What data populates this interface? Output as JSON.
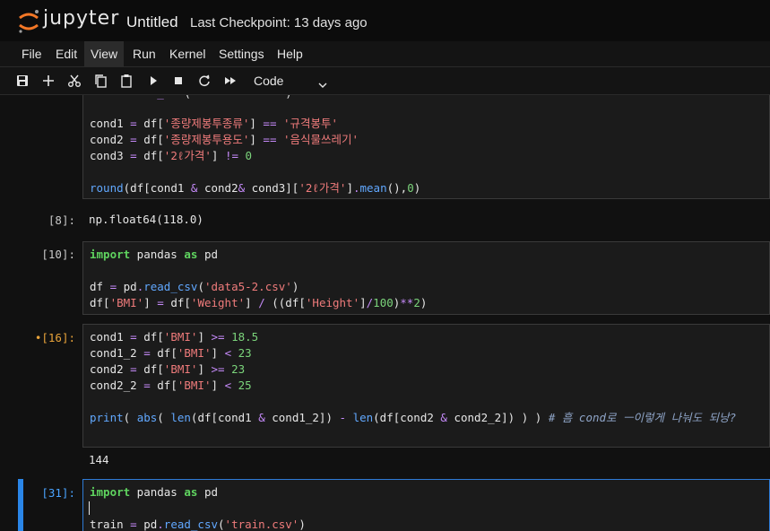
{
  "app": {
    "logo_text": "jupyter",
    "notebook_title": "Untitled",
    "checkpoint": "Last Checkpoint: 13 days ago"
  },
  "menu": {
    "items": [
      "File",
      "Edit",
      "View",
      "Run",
      "Kernel",
      "Settings",
      "Help"
    ],
    "active": "View"
  },
  "toolbar": {
    "icons": [
      "save-icon",
      "add-icon",
      "cut-icon",
      "copy-icon",
      "paste-icon",
      "run-icon",
      "stop-icon",
      "restart-icon",
      "fast-forward-icon"
    ],
    "cell_type": "Code"
  },
  "cells": [
    {
      "prompt": "",
      "lines": [
        "",
        "cond1 = df['종량제봉투종류'] == '규격봉투'",
        "cond2 = df['종량제봉투용도'] == '음식물쓰레기'",
        "cond3 = df['2ℓ가격'] != 0",
        "",
        "round(df[cond1 & cond2& cond3]['2ℓ가격'].mean(),0)"
      ],
      "output": {
        "prompt": "[8]:",
        "text": "np.float64(118.0)"
      }
    },
    {
      "prompt": "[10]:",
      "lines": [
        "import pandas as pd",
        "",
        "df = pd.read_csv('data5-2.csv')",
        "df['BMI'] = df['Weight'] / ((df['Height']/100)**2)"
      ]
    },
    {
      "prompt": "•[16]:",
      "lines": [
        "cond1 = df['BMI'] >= 18.5",
        "cond1_2 = df['BMI'] < 23",
        "cond2 = df['BMI'] >= 23",
        "cond2_2 = df['BMI'] < 25",
        "",
        "print( abs( len(df[cond1 & cond1_2]) - len(df[cond2 & cond2_2]) ) ) # 흠 cond로 ㅡ이렇게 나눠도 되낭?"
      ],
      "output": {
        "prompt": "",
        "text": "144"
      }
    },
    {
      "prompt": "[31]:",
      "lines": [
        "import pandas as pd",
        "",
        "train = pd.read_csv('train.csv')"
      ]
    }
  ],
  "colors": {
    "background": "#111111",
    "cell_border": "#3a3a3a",
    "active_cell": "#2a86e8",
    "keyword": "#5fd35f",
    "string": "#ef7b7b",
    "number": "#7bd47b",
    "operator": "#c58af9",
    "function": "#61a8ff",
    "comment": "#8fa5c8",
    "dirty_prompt": "#e8a33a"
  }
}
